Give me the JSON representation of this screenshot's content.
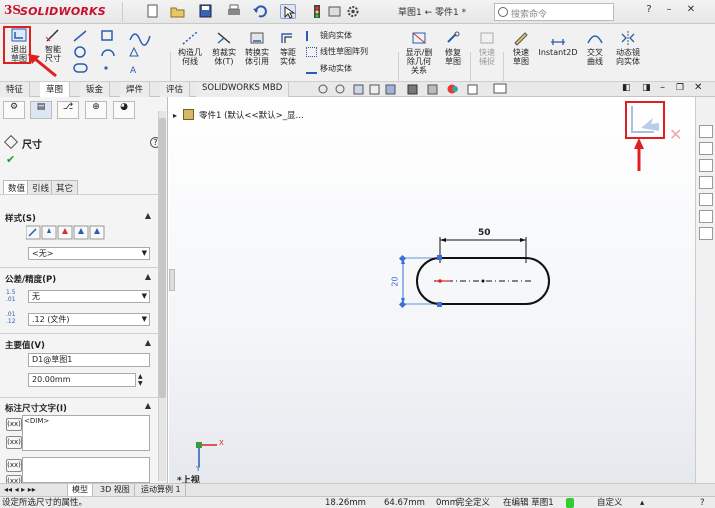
{
  "app": {
    "logo_ds": "3S",
    "logo_text": "SOLIDWORKS"
  },
  "titlebar": {
    "document_title": "草图1 ← 零件1 *",
    "search_placeholder": "搜索命令",
    "win_help": "?",
    "win_min": "–",
    "win_close": "✕"
  },
  "ribbon": {
    "exit_sketch": "退出草图",
    "smart_dim": "智能尺寸",
    "construct_geom": "构造几何线",
    "trim": "剪裁实体(T)",
    "convert": "转换实体引用",
    "offset": "等距实体",
    "mirror": "镜向实体",
    "linear_pattern": "线性草图阵列",
    "move": "移动实体",
    "show_delete": "显示/删除几何关系",
    "repair": "修复草图",
    "quick_snaps": "快速捕捉",
    "rapid_sketch": "快速草图",
    "instant2d": "Instant2D",
    "intersection": "交叉曲线",
    "dynamic_mirror": "动态镜向实体"
  },
  "tabs": [
    "特征",
    "草图",
    "钣金",
    "焊件",
    "评估",
    "SOLIDWORKS MBD"
  ],
  "panel": {
    "title": "尺寸",
    "help": "?",
    "subtabs": [
      "数值",
      "引线",
      "其它"
    ],
    "style_header": "样式(S)",
    "style_value": "<无>",
    "tolerance_header": "公差/精度(P)",
    "tolerance_type": "无",
    "precision": ".12 (文件)",
    "primary_header": "主要值(V)",
    "primary_name": "D1@草图1",
    "primary_value": "20.00mm",
    "dimtext_header": "标注尺寸文字(I)",
    "dimtext_value": "<DIM>",
    "dim_icon_label": "(xx)"
  },
  "canvas": {
    "tree_item": "零件1 (默认<<默认>_显...",
    "dim_horizontal": "50",
    "dim_vertical": "20",
    "view_label": "*上视",
    "axis_x": "X",
    "axis_y": "Y"
  },
  "bottom_tabs": [
    "模型",
    "3D 视图",
    "运动算例 1"
  ],
  "status": {
    "message": "设定所选尺寸的属性。",
    "x": "18.26mm",
    "y": "64.67mm",
    "z": "0mm",
    "state": "完全定义",
    "editing": "在编辑 草图1",
    "custom": "自定义"
  },
  "colors": {
    "accent_red": "#e02020",
    "sketch_black": "#111111",
    "blue_point": "#3b6fd6"
  }
}
